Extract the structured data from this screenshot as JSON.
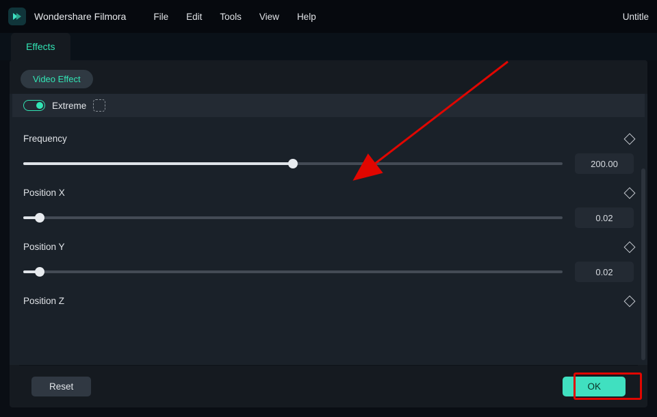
{
  "app": {
    "name": "Wondershare Filmora",
    "project": "Untitle"
  },
  "menus": [
    "File",
    "Edit",
    "Tools",
    "View",
    "Help"
  ],
  "tab": {
    "label": "Effects"
  },
  "pill": {
    "label": "Video Effect"
  },
  "effect": {
    "name": "Extreme"
  },
  "props": [
    {
      "label": "Frequency",
      "value": "200.00",
      "pct": 50
    },
    {
      "label": "Position X",
      "value": "0.02",
      "pct": 3
    },
    {
      "label": "Position Y",
      "value": "0.02",
      "pct": 3
    },
    {
      "label": "Position Z",
      "value": "",
      "pct": null
    }
  ],
  "buttons": {
    "reset": "Reset",
    "ok": "OK"
  }
}
